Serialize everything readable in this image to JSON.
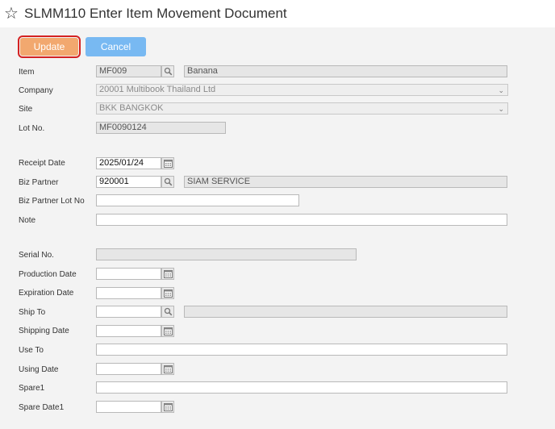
{
  "header": {
    "title": "SLMM110 Enter Item Movement Document",
    "star_icon": "star-outline-icon"
  },
  "toolbar": {
    "update_label": "Update",
    "cancel_label": "Cancel"
  },
  "colors": {
    "update": "#f2a86f",
    "update_highlight": "#d42222",
    "cancel": "#78b9f2",
    "form_bg": "#f3f3f3"
  },
  "form": {
    "item": {
      "label": "Item",
      "code": "MF009",
      "name": "Banana"
    },
    "company": {
      "label": "Company",
      "value": "20001 Multibook Thailand Ltd"
    },
    "site": {
      "label": "Site",
      "value": "BKK BANGKOK"
    },
    "lot_no": {
      "label": "Lot No.",
      "value": "MF0090124"
    },
    "receipt_date": {
      "label": "Receipt Date",
      "value": "2025/01/24"
    },
    "biz_partner": {
      "label": "Biz Partner",
      "code": "920001",
      "name": "SIAM SERVICE"
    },
    "biz_partner_lot_no": {
      "label": "Biz Partner Lot No",
      "value": ""
    },
    "note": {
      "label": "Note",
      "value": ""
    },
    "serial_no": {
      "label": "Serial No.",
      "value": ""
    },
    "production_date": {
      "label": "Production Date",
      "value": ""
    },
    "expiration_date": {
      "label": "Expiration Date",
      "value": ""
    },
    "ship_to": {
      "label": "Ship To",
      "code": "",
      "name": ""
    },
    "shipping_date": {
      "label": "Shipping Date",
      "value": ""
    },
    "use_to": {
      "label": "Use To",
      "value": ""
    },
    "using_date": {
      "label": "Using Date",
      "value": ""
    },
    "spare1": {
      "label": "Spare1",
      "value": ""
    },
    "spare_date1": {
      "label": "Spare Date1",
      "value": ""
    }
  }
}
